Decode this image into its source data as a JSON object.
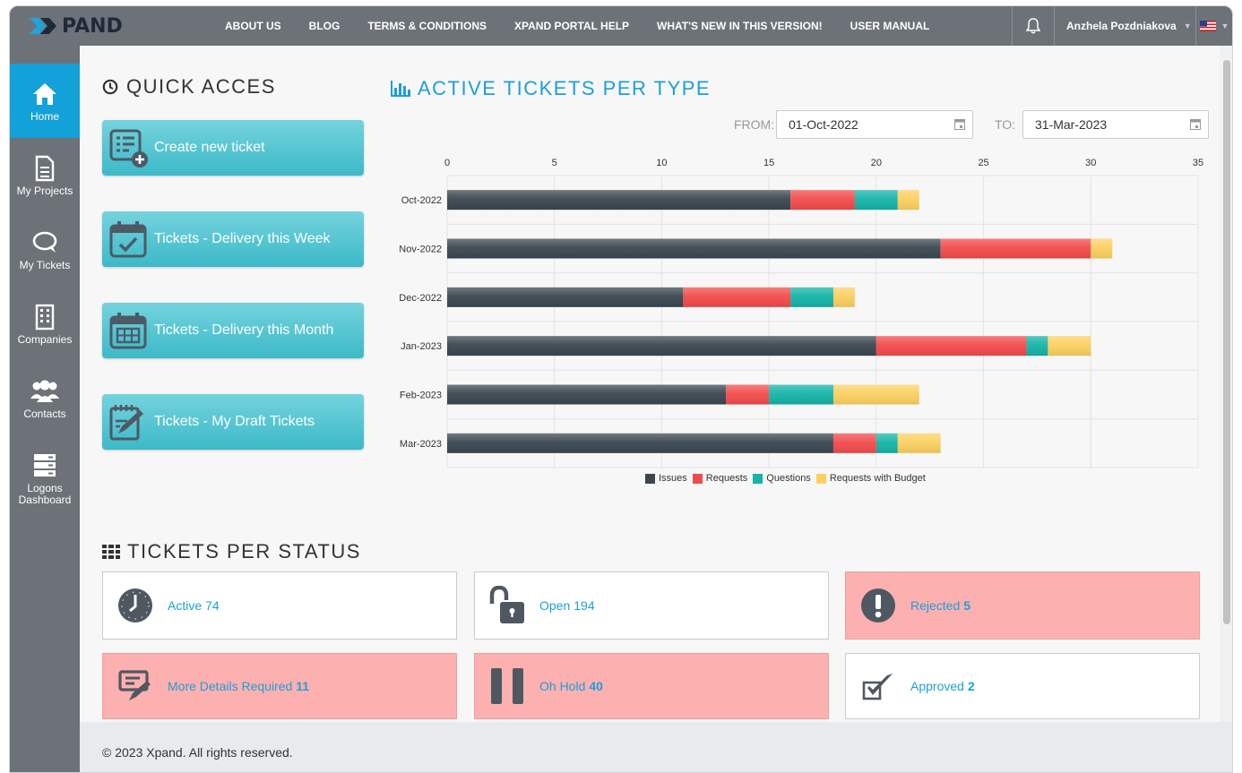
{
  "brand": {
    "logo_text": "PAND"
  },
  "nav": {
    "items": [
      "ABOUT US",
      "BLOG",
      "TERMS & CONDITIONS",
      "XPAND PORTAL HELP",
      "WHAT'S NEW IN THIS VERSION!",
      "USER MANUAL"
    ],
    "user_name": "Anzhela Pozdniakova"
  },
  "sidebar": {
    "items": [
      {
        "label": "Home",
        "icon": "home-icon",
        "active": true
      },
      {
        "label": "My Projects",
        "icon": "document-icon"
      },
      {
        "label": "My Tickets",
        "icon": "chat-icon"
      },
      {
        "label": "Companies",
        "icon": "building-icon"
      },
      {
        "label": "Contacts",
        "icon": "users-icon"
      },
      {
        "label": "Logons Dashboard",
        "icon": "server-icon"
      }
    ]
  },
  "quick_access": {
    "title": "QUICK ACCES",
    "buttons": [
      {
        "label": "Create new ticket",
        "icon": "ticket-add-icon"
      },
      {
        "label": "Tickets - Delivery this Week",
        "icon": "calendar-check-icon"
      },
      {
        "label": "Tickets - Delivery this Month",
        "icon": "calendar-month-icon"
      },
      {
        "label": "Tickets - My Draft Tickets",
        "icon": "draft-edit-icon"
      }
    ]
  },
  "chart_section": {
    "title": "ACTIVE TICKETS PER TYPE",
    "from_label": "FROM:",
    "from_value": "01-Oct-2022",
    "to_label": "TO:",
    "to_value": "31-Mar-2023"
  },
  "chart_data": {
    "type": "bar",
    "orientation": "horizontal",
    "stacked": true,
    "categories": [
      "Oct-2022",
      "Nov-2022",
      "Dec-2022",
      "Jan-2023",
      "Feb-2023",
      "Mar-2023"
    ],
    "series": [
      {
        "name": "Issues",
        "color": "#3b4650",
        "values": [
          16,
          23,
          11,
          20,
          13,
          18
        ]
      },
      {
        "name": "Requests",
        "color": "#f24b4b",
        "values": [
          3,
          7,
          5,
          7,
          2,
          2
        ]
      },
      {
        "name": "Questions",
        "color": "#15b3a8",
        "values": [
          2,
          0,
          2,
          1,
          3,
          1
        ]
      },
      {
        "name": "Requests with Budget",
        "color": "#fbd060",
        "values": [
          1,
          1,
          1,
          2,
          4,
          2
        ]
      }
    ],
    "xlim": [
      0,
      35
    ],
    "xticks": [
      "0",
      "5",
      "10",
      "15",
      "20",
      "25",
      "30",
      "35"
    ],
    "grid": true,
    "legend_position": "bottom"
  },
  "status_section": {
    "title": "TICKETS PER STATUS",
    "tiles": [
      {
        "label": "Active",
        "count": "74",
        "icon": "clock-icon",
        "pink": false
      },
      {
        "label": "Open",
        "count": "194",
        "icon": "unlocked-icon",
        "pink": false
      },
      {
        "label": "Rejected",
        "count": "5",
        "icon": "exclamation-icon",
        "pink": true
      },
      {
        "label": "More Details Required",
        "count": "11",
        "icon": "form-edit-icon",
        "pink": true
      },
      {
        "label": "Oh Hold",
        "count": "40",
        "icon": "pause-icon",
        "pink": true
      },
      {
        "label": "Approved",
        "count": "2",
        "icon": "checkbox-icon",
        "pink": false
      }
    ]
  },
  "footer": {
    "text": "© 2023 Xpand. All rights reserved."
  }
}
